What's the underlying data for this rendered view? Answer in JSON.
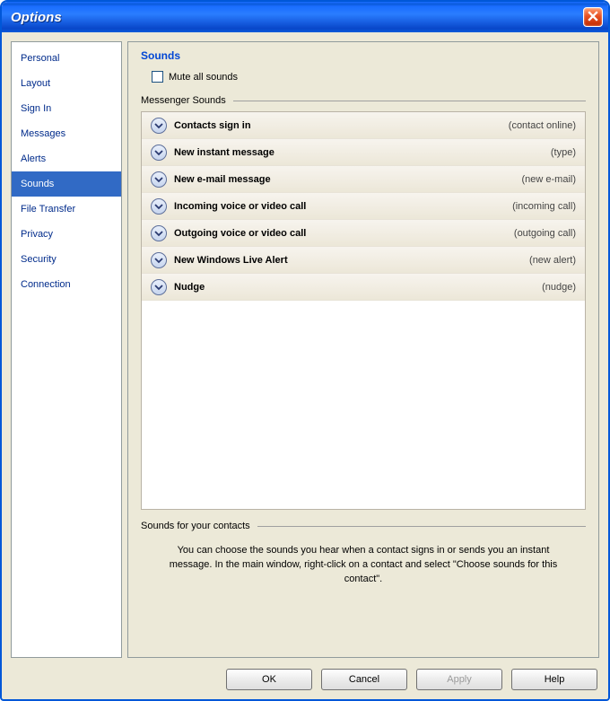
{
  "window": {
    "title": "Options"
  },
  "sidebar": {
    "items": [
      {
        "label": "Personal"
      },
      {
        "label": "Layout"
      },
      {
        "label": "Sign In"
      },
      {
        "label": "Messages"
      },
      {
        "label": "Alerts"
      },
      {
        "label": "Sounds"
      },
      {
        "label": "File Transfer"
      },
      {
        "label": "Privacy"
      },
      {
        "label": "Security"
      },
      {
        "label": "Connection"
      }
    ],
    "selected_index": 5
  },
  "panel": {
    "title": "Sounds",
    "mute_label": "Mute all sounds",
    "group_label": "Messenger Sounds",
    "sounds": [
      {
        "label": "Contacts sign in",
        "value": "(contact online)"
      },
      {
        "label": "New instant message",
        "value": "(type)"
      },
      {
        "label": "New e-mail message",
        "value": "(new e-mail)"
      },
      {
        "label": "Incoming voice or video call",
        "value": "(incoming call)"
      },
      {
        "label": "Outgoing voice or video call",
        "value": "(outgoing call)"
      },
      {
        "label": "New Windows Live Alert",
        "value": "(new alert)"
      },
      {
        "label": "Nudge",
        "value": "(nudge)"
      }
    ],
    "contacts_group_label": "Sounds for your contacts",
    "help_text": "You can choose the sounds you hear when a contact signs in or sends you an instant message.  In the main window, right-click on a contact and select \"Choose sounds for this contact\"."
  },
  "buttons": {
    "ok": "OK",
    "cancel": "Cancel",
    "apply": "Apply",
    "help": "Help"
  }
}
